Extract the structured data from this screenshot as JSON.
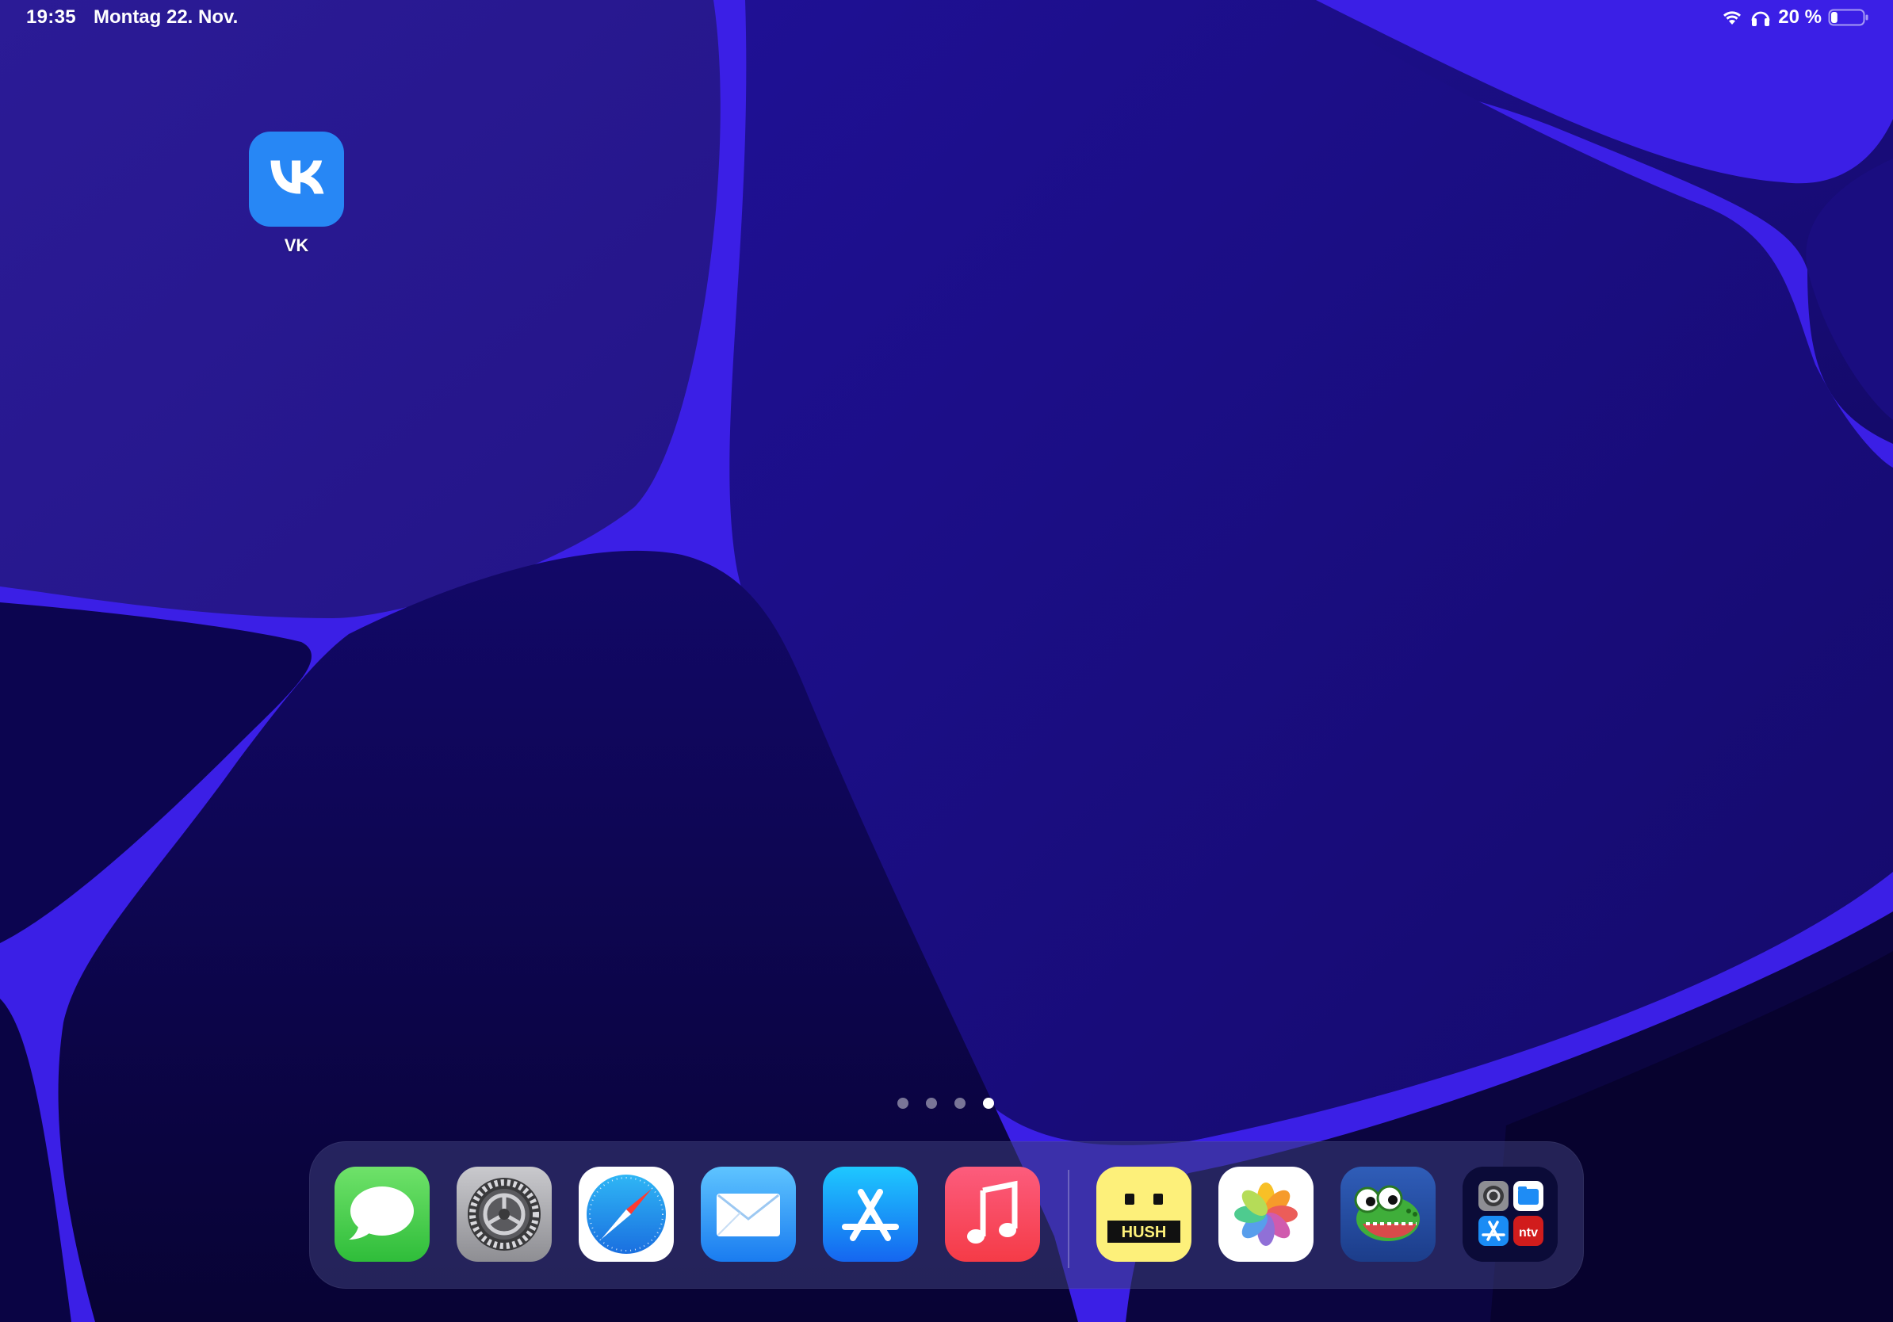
{
  "status_bar": {
    "time": "19:35",
    "date": "Montag 22. Nov.",
    "battery_percent": "20 %",
    "battery_level": 0.2,
    "icons": [
      "wifi-icon",
      "headphones-icon",
      "battery-icon"
    ]
  },
  "home_screen": {
    "apps": [
      {
        "label": "VK",
        "icon": "vk-icon",
        "color": "#2787f5"
      }
    ],
    "page_count": 4,
    "current_page": 4
  },
  "dock": {
    "apps": [
      {
        "icon": "messages-icon"
      },
      {
        "icon": "settings-icon"
      },
      {
        "icon": "safari-icon"
      },
      {
        "icon": "mail-icon"
      },
      {
        "icon": "app-store-icon"
      },
      {
        "icon": "music-icon"
      }
    ],
    "recent_apps": [
      {
        "icon": "hush-icon",
        "text": "HUSH"
      },
      {
        "icon": "photos-icon"
      },
      {
        "icon": "crocodile-game-icon"
      },
      {
        "icon": "app-library-icon",
        "badge_text": "ntv"
      }
    ]
  },
  "colors": {
    "wallpaper_base": "#1c0f7a",
    "accent_purple": "#4a1ff0",
    "vk_blue": "#2787f5"
  }
}
